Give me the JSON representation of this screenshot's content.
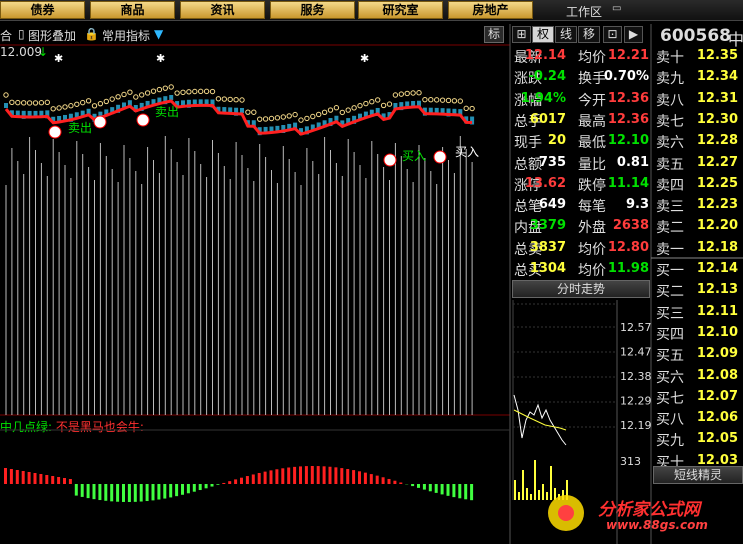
{
  "menu": [
    "债券",
    "商品",
    "资讯",
    "服务",
    "研究室",
    "房地产"
  ],
  "workarea": "工作区",
  "stock": {
    "code": "600568",
    "name": "中"
  },
  "toolbar": {
    "left_fragment": "合",
    "overlay": "图形叠加",
    "common_indicator": "常用指标",
    "mark_button": "标",
    "price_label": "12.009"
  },
  "side_tabs": [
    "权",
    "线",
    "移"
  ],
  "quote_rows": [
    {
      "l1": "最新",
      "v1": "12.14",
      "c1": "red",
      "l2": "均价",
      "v2": "12.21",
      "c2": "red"
    },
    {
      "l1": "涨跌",
      "v1": "-0.24",
      "c1": "green",
      "l2": "换手",
      "v2": "0.70%",
      "c2": "white"
    },
    {
      "l1": "涨幅",
      "v1": "1.94%",
      "c1": "green",
      "l2": "今开",
      "v2": "12.36",
      "c2": "red"
    },
    {
      "l1": "总手",
      "v1": "6017",
      "c1": "yellow",
      "l2": "最高",
      "v2": "12.36",
      "c2": "red"
    },
    {
      "l1": "现手",
      "v1": "20",
      "c1": "yellow",
      "l2": "最低",
      "v2": "12.10",
      "c2": "green"
    },
    {
      "l1": "总额",
      "v1": "735",
      "c1": "white",
      "l2": "量比",
      "v2": "0.81",
      "c2": "white"
    },
    {
      "l1": "涨停",
      "v1": "13.62",
      "c1": "red",
      "l2": "跌停",
      "v2": "11.14",
      "c2": "green"
    },
    {
      "l1": "总笔",
      "v1": "649",
      "c1": "white",
      "l2": "每笔",
      "v2": "9.3",
      "c2": "white"
    },
    {
      "l1": "内盘",
      "v1": "3379",
      "c1": "green",
      "l2": "外盘",
      "v2": "2638",
      "c2": "red"
    },
    {
      "l1": "总卖",
      "v1": "3837",
      "c1": "yellow",
      "l2": "均价",
      "v2": "12.80",
      "c2": "red"
    },
    {
      "l1": "总买",
      "v1": "1304",
      "c1": "yellow",
      "l2": "均价",
      "v2": "11.98",
      "c2": "green"
    }
  ],
  "sell_book": [
    {
      "label": "卖十",
      "price": "12.35"
    },
    {
      "label": "卖九",
      "price": "12.34"
    },
    {
      "label": "卖八",
      "price": "12.31"
    },
    {
      "label": "卖七",
      "price": "12.30"
    },
    {
      "label": "卖六",
      "price": "12.28"
    },
    {
      "label": "卖五",
      "price": "12.27"
    },
    {
      "label": "卖四",
      "price": "12.25"
    },
    {
      "label": "卖三",
      "price": "12.23"
    },
    {
      "label": "卖二",
      "price": "12.20"
    },
    {
      "label": "卖一",
      "price": "12.18"
    }
  ],
  "buy_book": [
    {
      "label": "买一",
      "price": "12.14"
    },
    {
      "label": "买二",
      "price": "12.13"
    },
    {
      "label": "买三",
      "price": "12.11"
    },
    {
      "label": "买四",
      "price": "12.10"
    },
    {
      "label": "买五",
      "price": "12.09"
    },
    {
      "label": "买六",
      "price": "12.08"
    },
    {
      "label": "买七",
      "price": "12.07"
    },
    {
      "label": "买八",
      "price": "12.06"
    },
    {
      "label": "买九",
      "price": "12.05"
    },
    {
      "label": "买十",
      "price": "12.03"
    }
  ],
  "mini_chart": {
    "title": "分时走势",
    "price_ticks": [
      "12.57",
      "12.47",
      "12.38",
      "12.29",
      "12.19"
    ],
    "volume_tick": "313"
  },
  "short_elf": "短线精灵",
  "indicator": {
    "prefix": "中几点绿:",
    "text": "不是黑马也会牛:"
  },
  "signals": {
    "sell": "卖出",
    "buy": "买入"
  },
  "watermark": {
    "site": "分析家公式网",
    "url": "www.88gs.com"
  },
  "colors": {
    "up": "#ff3c3c",
    "down": "#00e000",
    "ma": "#ff2020",
    "accent": "#f4d98a"
  }
}
